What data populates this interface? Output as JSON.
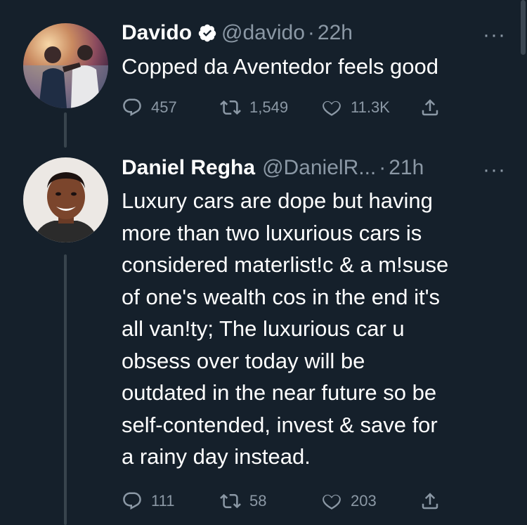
{
  "tweets": [
    {
      "name": "Davido",
      "verified": true,
      "handle": "@davido",
      "separator": "·",
      "time": "22h",
      "more": "···",
      "text": "Copped da Aventedor feels good",
      "replies": "457",
      "retweets": "1,549",
      "likes": "11.3K"
    },
    {
      "name": "Daniel Regha",
      "verified": false,
      "handle": "@DanielR...",
      "separator": "·",
      "time": "21h",
      "more": "···",
      "text_lines": [
        "Luxury cars are dope but having",
        "more than two luxurious cars is",
        "considered materlist!c & a m!suse",
        "of one's wealth cos in the end it's",
        "all van!ty; The luxurious car u",
        "obsess over today will be",
        "outdated in the near future so be",
        "self-contended, invest & save for",
        "a rainy day instead."
      ],
      "replies": "111",
      "retweets": "58",
      "likes": "203"
    }
  ],
  "icons": {
    "reply": "reply-icon",
    "retweet": "retweet-icon",
    "like": "heart-icon",
    "share": "share-icon",
    "verified": "verified-badge-icon"
  },
  "colors": {
    "background": "#15202b",
    "secondary_text": "#8b98a5",
    "verified_badge": "#ffffff",
    "thread_line": "#38444d"
  }
}
